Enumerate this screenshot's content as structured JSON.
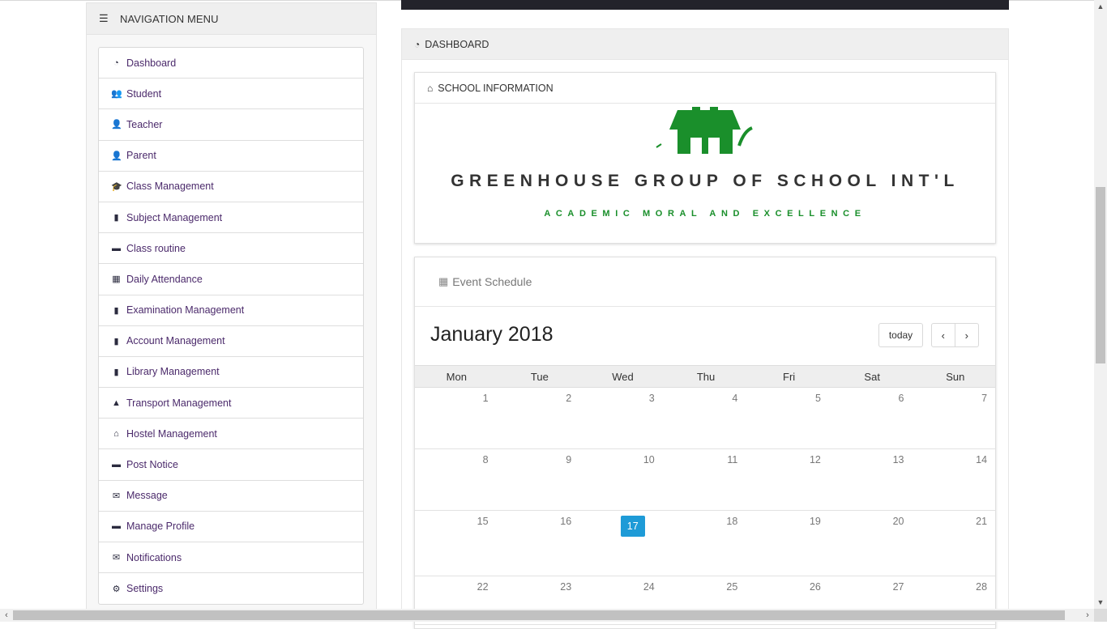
{
  "sidebar": {
    "title": "NAVIGATION MENU",
    "icon": "hamburger-icon",
    "items": [
      {
        "label": "Dashboard",
        "icon": "dashboard-icon"
      },
      {
        "label": "Student",
        "icon": "users-icon"
      },
      {
        "label": "Teacher",
        "icon": "teacher-icon"
      },
      {
        "label": "Parent",
        "icon": "user-icon"
      },
      {
        "label": "Class Management",
        "icon": "graduation-cap-icon"
      },
      {
        "label": "Subject Management",
        "icon": "book-icon"
      },
      {
        "label": "Class routine",
        "icon": "board-icon"
      },
      {
        "label": "Daily Attendance",
        "icon": "calendar-icon"
      },
      {
        "label": "Examination Management",
        "icon": "book-icon"
      },
      {
        "label": "Account Management",
        "icon": "bar-chart-icon"
      },
      {
        "label": "Library Management",
        "icon": "book-icon"
      },
      {
        "label": "Transport Management",
        "icon": "road-icon"
      },
      {
        "label": "Hostel Management",
        "icon": "home-icon"
      },
      {
        "label": "Post Notice",
        "icon": "board-icon"
      },
      {
        "label": "Message",
        "icon": "envelope-icon"
      },
      {
        "label": "Manage Profile",
        "icon": "briefcase-icon"
      },
      {
        "label": "Notifications",
        "icon": "envelope-icon"
      },
      {
        "label": "Settings",
        "icon": "gear-icon"
      }
    ]
  },
  "dashboard": {
    "title": "DASHBOARD",
    "school_info": {
      "title": "SCHOOL INFORMATION",
      "name": "GREENHOUSE GROUP OF SCHOOL INT'L",
      "motto": "ACADEMIC MORAL AND EXCELLENCE",
      "brand_color": "#1a8f2b"
    },
    "calendar": {
      "header": "Event Schedule",
      "month_title": "January 2018",
      "today_label": "today",
      "prev_label": "‹",
      "next_label": "›",
      "days_of_week": [
        "Mon",
        "Tue",
        "Wed",
        "Thu",
        "Fri",
        "Sat",
        "Sun"
      ],
      "weeks": [
        [
          "1",
          "2",
          "3",
          "4",
          "5",
          "6",
          "7"
        ],
        [
          "8",
          "9",
          "10",
          "11",
          "12",
          "13",
          "14"
        ],
        [
          "15",
          "16",
          "17",
          "18",
          "19",
          "20",
          "21"
        ],
        [
          "22",
          "23",
          "24",
          "25",
          "26",
          "27",
          "28"
        ]
      ],
      "today_date": "17",
      "today_color": "#1e9bd7"
    }
  }
}
